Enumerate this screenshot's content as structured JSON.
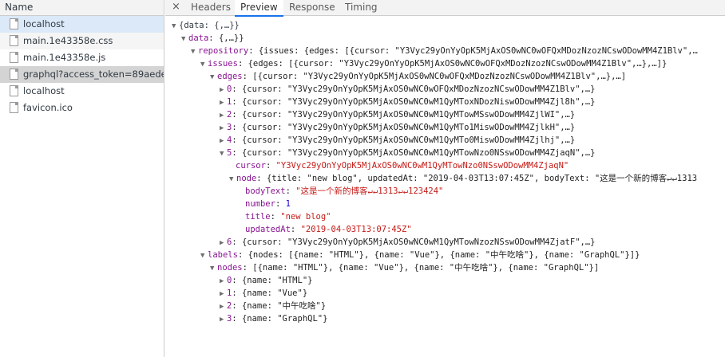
{
  "network": {
    "header": "Name",
    "requests": [
      {
        "name": "localhost"
      },
      {
        "name": "main.1e43358e.css"
      },
      {
        "name": "main.1e43358e.js"
      },
      {
        "name": "graphql?access_token=89aede..."
      },
      {
        "name": "localhost"
      },
      {
        "name": "favicon.ico"
      }
    ]
  },
  "tabs": {
    "close": "×",
    "items": [
      "Headers",
      "Preview",
      "Response",
      "Timing"
    ],
    "active": "Preview"
  },
  "preview": {
    "lines": [
      {
        "arrow": "▼",
        "key": "",
        "rest": "{data: {,…}}"
      },
      {
        "arrow": "▼",
        "key": "data",
        "rest": ": {,…}}"
      },
      {
        "arrow": "▼",
        "key": "repository",
        "rest": ": {issues: {edges: [{cursor: \"Y3Vyc29yOnYyOpK5MjAxOS0wNC0wOFQxMDozNzozNCswODowMM4Z1Blv\",…"
      },
      {
        "arrow": "▼",
        "key": "issues",
        "rest": ": {edges: [{cursor: \"Y3Vyc29yOnYyOpK5MjAxOS0wNC0wOFQxMDozNzozNCswODowMM4Z1Blv\",…},…]}"
      },
      {
        "arrow": "▼",
        "key": "edges",
        "rest": ": [{cursor: \"Y3Vyc29yOnYyOpK5MjAxOS0wNC0wOFQxMDozNzozNCswODowMM4Z1Blv\",…},…]"
      },
      {
        "arrow": "▶",
        "key": "0",
        "rest": ": {cursor: \"Y3Vyc29yOnYyOpK5MjAxOS0wNC0wOFQxMDozNzozNCswODowMM4Z1Blv\",…}"
      },
      {
        "arrow": "▶",
        "key": "1",
        "rest": ": {cursor: \"Y3Vyc29yOnYyOpK5MjAxOS0wNC0wM1QyMToxNDozNiswODowMM4Zjl8h\",…}"
      },
      {
        "arrow": "▶",
        "key": "2",
        "rest": ": {cursor: \"Y3Vyc29yOnYyOpK5MjAxOS0wNC0wM1QyMTowMSswODowMM4ZjlWI\",…}"
      },
      {
        "arrow": "▶",
        "key": "3",
        "rest": ": {cursor: \"Y3Vyc29yOnYyOpK5MjAxOS0wNC0wM1QyMTo1MiswODowMM4ZjlkH\",…}"
      },
      {
        "arrow": "▶",
        "key": "4",
        "rest": ": {cursor: \"Y3Vyc29yOnYyOpK5MjAxOS0wNC0wM1QyMTo0MiswODowMM4Zjlhj\",…}"
      },
      {
        "arrow": "▼",
        "key": "5",
        "rest": ": {cursor: \"Y3Vyc29yOnYyOpK5MjAxOS0wNC0wM1QyMTowNzo0NSswODowMM4ZjaqN\",…}"
      },
      {
        "arrow": "",
        "key": "cursor",
        "rest": ": ",
        "str": "\"Y3Vyc29yOnYyOpK5MjAxOS0wNC0wM1QyMTowNzo0NSswODowMM4ZjaqN\""
      },
      {
        "arrow": "▼",
        "key": "node",
        "rest": ": {title: \"new blog\", updatedAt: \"2019-04-03T13:07:45Z\", bodyText: \"这是一个新的博客↵↵1313"
      },
      {
        "arrow": "",
        "key": "bodyText",
        "rest": ": ",
        "str": "\"这是一个新的博客↵↵1313↵↵123424\""
      },
      {
        "arrow": "",
        "key": "number",
        "rest": ": ",
        "num": "1"
      },
      {
        "arrow": "",
        "key": "title",
        "rest": ": ",
        "str": "\"new blog\""
      },
      {
        "arrow": "",
        "key": "updatedAt",
        "rest": ": ",
        "str": "\"2019-04-03T13:07:45Z\""
      },
      {
        "arrow": "▶",
        "key": "6",
        "rest": ": {cursor: \"Y3Vyc29yOnYyOpK5MjAxOS0wNC0wM1QyMTowNzozNSswODowMM4ZjatF\",…}"
      },
      {
        "arrow": "▼",
        "key": "labels",
        "rest": ": {nodes: [{name: \"HTML\"}, {name: \"Vue\"}, {name: \"中午吃啥\"}, {name: \"GraphQL\"}]}"
      },
      {
        "arrow": "▼",
        "key": "nodes",
        "rest": ": [{name: \"HTML\"}, {name: \"Vue\"}, {name: \"中午吃啥\"}, {name: \"GraphQL\"}]"
      },
      {
        "arrow": "▶",
        "key": "0",
        "rest": ": {name: \"HTML\"}"
      },
      {
        "arrow": "▶",
        "key": "1",
        "rest": ": {name: \"Vue\"}"
      },
      {
        "arrow": "▶",
        "key": "2",
        "rest": ": {name: \"中午吃啥\"}"
      },
      {
        "arrow": "▶",
        "key": "3",
        "rest": ": {name: \"GraphQL\"}"
      }
    ]
  }
}
